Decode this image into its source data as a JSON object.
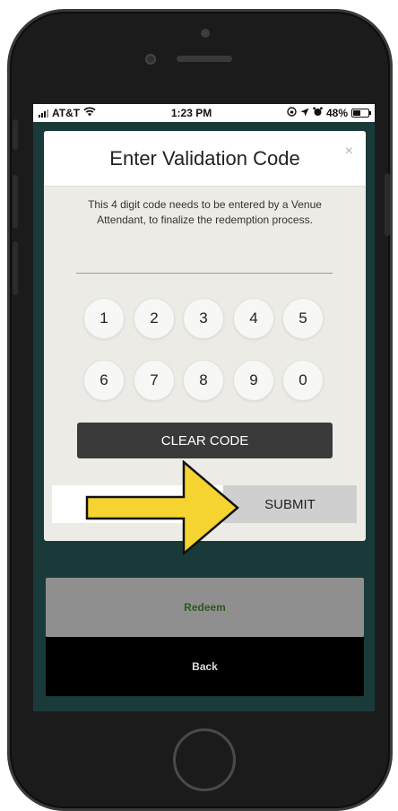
{
  "status_bar": {
    "carrier": "AT&T",
    "time": "1:23 PM",
    "battery": "48%",
    "battery_level": 0.48,
    "icons": [
      "signal-icon",
      "wifi-icon",
      "lock-rotation-icon",
      "location-icon",
      "alarm-icon",
      "battery-icon"
    ]
  },
  "modal": {
    "title": "Enter Validation Code",
    "close_glyph": "×",
    "description": "This 4 digit code needs to be entered by a Venue Attendant, to finalize the redemption process.",
    "keys": [
      "1",
      "2",
      "3",
      "4",
      "5",
      "6",
      "7",
      "8",
      "9",
      "0"
    ],
    "clear_label": "CLEAR CODE",
    "submit_label": "SUBMIT"
  },
  "actions": {
    "redeem_label": "Redeem",
    "back_label": "Back"
  },
  "colors": {
    "screen_background": "#1a3a3a",
    "modal_background": "#ecebe5",
    "clear_button": "#3a3a3a",
    "submit_button": "#cfcfcf",
    "redeem_button": "#8f8f8f",
    "redeem_text": "#2c5a1c",
    "arrow_fill": "#f5d330"
  }
}
